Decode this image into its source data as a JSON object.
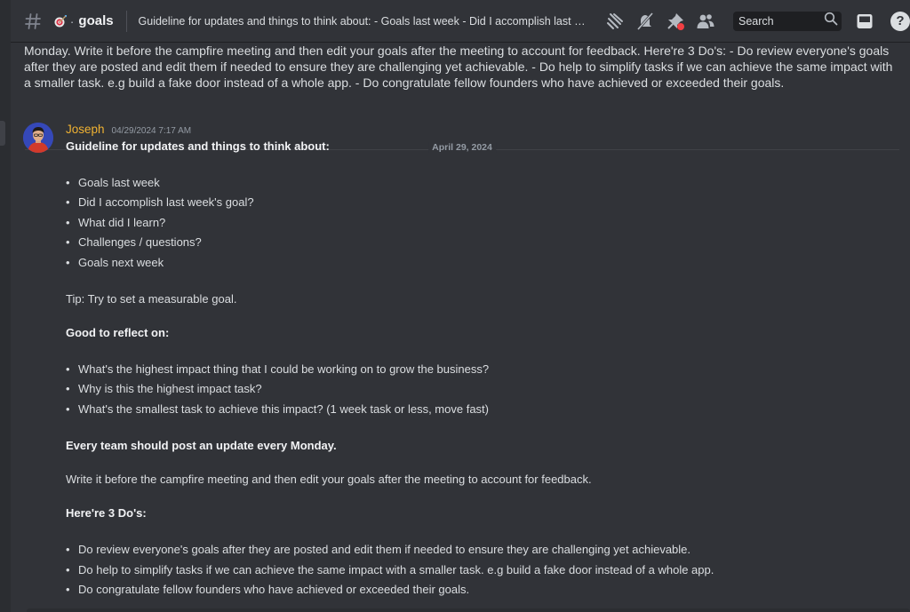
{
  "header": {
    "channel_name": "goals",
    "channel_separator": "·",
    "topic": "Guideline for updates and things to think about: - Goals last week - Did I accomplish last week's goal? - W...",
    "search_placeholder": "Search",
    "help_label": "?"
  },
  "icons": {
    "hash": "hash-icon",
    "channel_emoji": "dart-icon",
    "threads": "threads-icon",
    "notifications": "bell-muted-icon",
    "pinned": "pin-icon",
    "members": "members-icon",
    "search": "search-icon",
    "inbox": "inbox-icon",
    "help": "help-icon"
  },
  "previous_message": {
    "text": "Monday. Write it before the campfire meeting and then edit your goals after the meeting to account for feedback. Here're 3 Do's: - Do review everyone's goals after they are posted and edit them if needed to ensure they are challenging yet achievable. - Do help to simplify tasks if we can achieve the same impact with a smaller task. e.g build a fake door instead of a whole app. - Do congratulate fellow founders who have achieved or exceeded their goals."
  },
  "date_divider": "April 29, 2024",
  "message": {
    "author": "Joseph",
    "timestamp": "04/29/2024 7:17 AM",
    "heading": "Guideline for updates and things to think about:",
    "guideline_items": [
      "Goals last week",
      "Did I accomplish last week's goal?",
      "What did I learn?",
      "Challenges / questions?",
      "Goals next week"
    ],
    "tip": "Tip: Try to set a measurable goal.",
    "reflect_heading": "Good to reflect on:",
    "reflect_items": [
      "What's the highest impact thing that I could be working on to grow the business?",
      "Why is this the highest impact task?",
      "What's the smallest task to achieve this impact? (1 week task or less, move fast)"
    ],
    "monday_heading": "Every team should post an update every Monday.",
    "monday_text": "Write it before the campfire meeting and then edit your goals after the meeting to account for feedback.",
    "dos_heading": "Here're 3 Do's:",
    "dos_items": [
      "Do review everyone's goals after they are posted and edit them if needed to ensure they are challenging yet achievable.",
      "Do help to simplify tasks if we can achieve the same impact with a smaller task. e.g build a fake door instead of a whole app.",
      "Do congratulate fellow founders who have achieved or exceeded their goals."
    ]
  },
  "colors": {
    "background": "#313338",
    "username": "#f0b232",
    "text": "#dbdee1",
    "muted": "#949ba4"
  }
}
